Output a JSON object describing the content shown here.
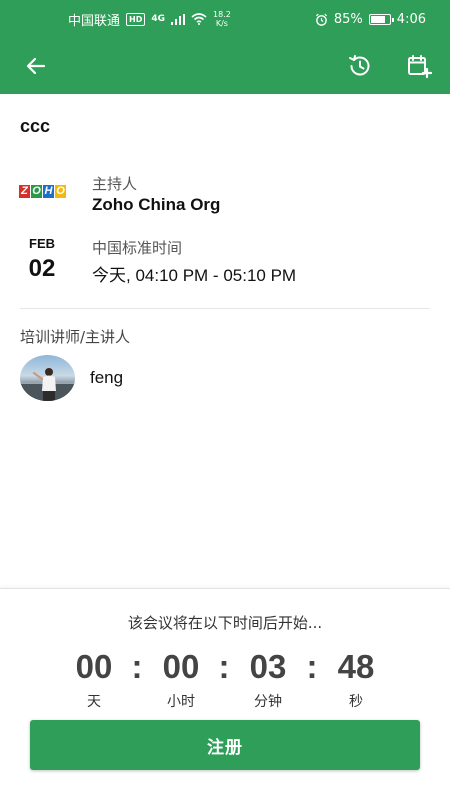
{
  "status_bar": {
    "carrier": "中国联通",
    "hd": "HD",
    "network": "4G",
    "speed_value": "18.2",
    "speed_unit": "K/s",
    "battery": "85%",
    "battery_level": 0.85,
    "time": "4:06"
  },
  "app_bar": {
    "icons": [
      "back-arrow-icon",
      "history-icon",
      "calendar-add-icon"
    ]
  },
  "event": {
    "title": "ccc",
    "host_label": "主持人",
    "host_name": "Zoho China Org",
    "logo_letters": [
      "Z",
      "O",
      "H",
      "O"
    ],
    "date_month": "FEB",
    "date_day": "02",
    "timezone_label": "中国标准时间",
    "time_range": "今天, 04:10 PM - 05:10 PM"
  },
  "speakers": {
    "label": "培训讲师/主讲人",
    "items": [
      {
        "name": "feng"
      }
    ]
  },
  "countdown": {
    "caption": "该会议将在以下时间后开始...",
    "days": "00",
    "hours": "00",
    "minutes": "03",
    "seconds": "48",
    "separator": ":",
    "days_label": "天",
    "hours_label": "小时",
    "minutes_label": "分钟",
    "seconds_label": "秒"
  },
  "register_button": "注册",
  "colors": {
    "primary": "#2f9e59",
    "logo": [
      "#d6302b",
      "#2a9a49",
      "#1f6fc5",
      "#f2b90f"
    ]
  }
}
